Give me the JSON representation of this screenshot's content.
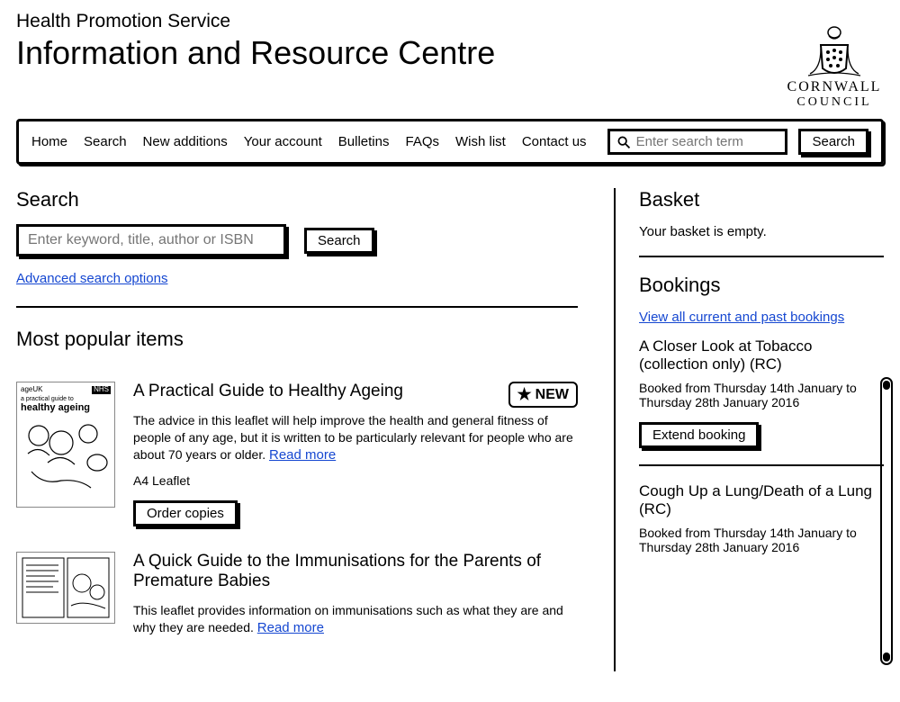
{
  "header": {
    "subtitle": "Health Promotion Service",
    "title": "Information and Resource Centre",
    "council_line1": "CORNWALL",
    "council_line2": "COUNCIL"
  },
  "nav": {
    "items": [
      "Home",
      "Search",
      "New additions",
      "Your account",
      "Bulletins",
      "FAQs",
      "Wish list",
      "Contact us"
    ],
    "search_placeholder": "Enter search term",
    "search_button": "Search"
  },
  "search_panel": {
    "heading": "Search",
    "input_placeholder": "Enter keyword, title, author or ISBN",
    "button": "Search",
    "advanced_link": "Advanced search options"
  },
  "popular": {
    "heading": "Most popular items",
    "new_badge": "NEW",
    "items": [
      {
        "title": "A Practical Guide to Healthy Ageing",
        "desc": "The advice in this leaflet will help improve the health and general fitness of people of any age, but it is written to be particularly relevant for people who are about 70 years or older.",
        "read_more": "Read more",
        "format": "A4 Leaflet",
        "order_button": "Order copies",
        "is_new": true,
        "thumb_logo_left": "ageUK",
        "thumb_logo_right": "NHS",
        "thumb_sub": "a practical guide to",
        "thumb_big": "healthy ageing"
      },
      {
        "title": "A Quick Guide to the Immunisations for the Parents of Premature Babies",
        "desc": "This leaflet provides information on immunisations such as what they are and why they are needed.",
        "read_more": "Read more",
        "format": "",
        "order_button": "",
        "is_new": false
      }
    ]
  },
  "basket": {
    "heading": "Basket",
    "empty_text": "Your basket is empty."
  },
  "bookings": {
    "heading": "Bookings",
    "view_all_link": "View all current and past bookings",
    "items": [
      {
        "title": "A Closer Look at Tobacco (collection only) (RC)",
        "dates": "Booked from Thursday 14th January to Thursday 28th January 2016",
        "extend_button": "Extend booking"
      },
      {
        "title": "Cough Up a Lung/Death of a Lung (RC)",
        "dates": "Booked from Thursday 14th January to Thursday 28th January 2016",
        "extend_button": ""
      }
    ]
  }
}
